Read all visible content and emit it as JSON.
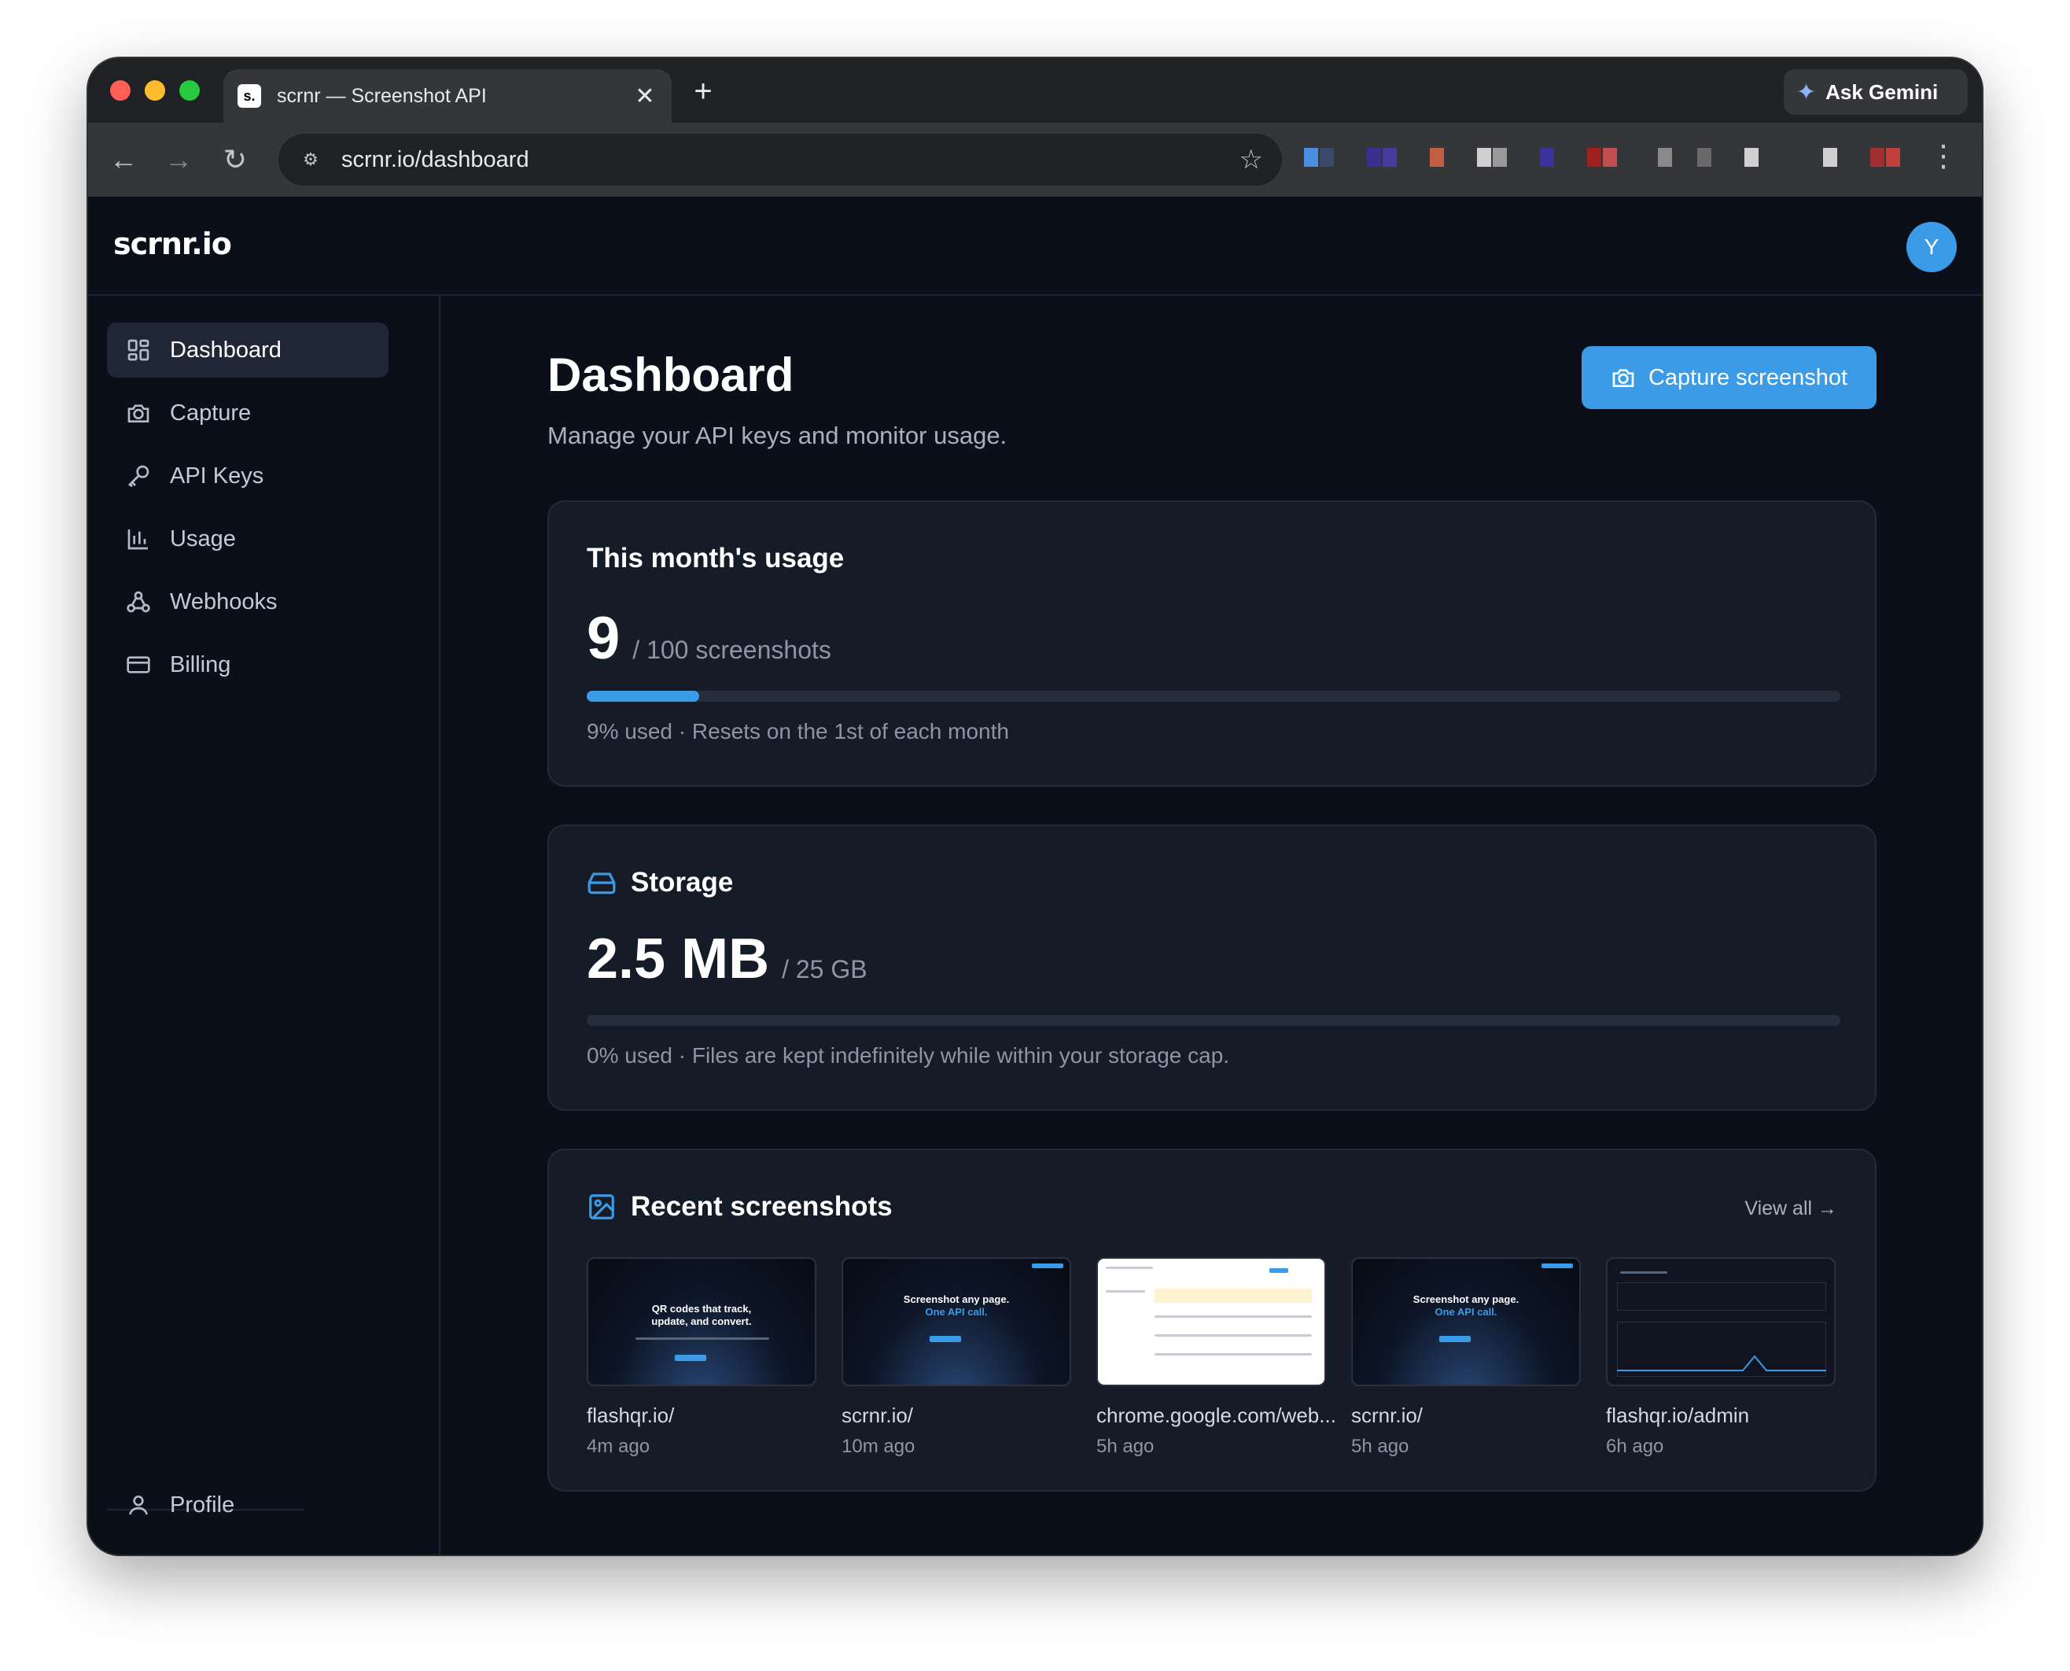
{
  "browser": {
    "tab_title": "scrnr — Screenshot API",
    "favicon_text": "s.",
    "new_tab": "+",
    "close": "✕",
    "gemini_label": "Ask Gemini",
    "url": "scrnr.io/dashboard"
  },
  "app": {
    "brand": "scrnr.io",
    "avatar_initial": "Y"
  },
  "sidebar": {
    "items": [
      {
        "label": "Dashboard",
        "icon": "dashboard-grid-icon",
        "active": true
      },
      {
        "label": "Capture",
        "icon": "camera-icon"
      },
      {
        "label": "API Keys",
        "icon": "key-icon"
      },
      {
        "label": "Usage",
        "icon": "bar-chart-icon"
      },
      {
        "label": "Webhooks",
        "icon": "webhook-icon"
      },
      {
        "label": "Billing",
        "icon": "credit-card-icon"
      }
    ],
    "profile_label": "Profile"
  },
  "main": {
    "title": "Dashboard",
    "subtitle": "Manage your API keys and monitor usage.",
    "capture_button": "Capture screenshot"
  },
  "usage_card": {
    "title": "This month's usage",
    "value": "9",
    "unit": "/ 100 screenshots",
    "percent_used": 0.09,
    "note": "9% used · Resets on the 1st of each month"
  },
  "storage_card": {
    "title": "Storage",
    "value": "2.5 MB",
    "unit": "/ 25 GB",
    "percent_used": 0.0,
    "note": "0% used · Files are kept indefinitely while within your storage cap."
  },
  "recent": {
    "title": "Recent screenshots",
    "view_all": "View all →",
    "items": [
      {
        "name": "flashqr.io/",
        "time": "4m ago",
        "thumb_heading": "QR codes that track,",
        "thumb_heading2": "update, and convert."
      },
      {
        "name": "scrnr.io/",
        "time": "10m ago",
        "thumb_heading": "Screenshot any page.",
        "thumb_heading2": "One API call."
      },
      {
        "name": "chrome.google.com/web...",
        "time": "5h ago"
      },
      {
        "name": "scrnr.io/",
        "time": "5h ago",
        "thumb_heading": "Screenshot any page.",
        "thumb_heading2": "One API call."
      },
      {
        "name": "flashqr.io/admin",
        "time": "6h ago"
      }
    ]
  },
  "colors": {
    "accent": "#3b9be6",
    "background": "#0b0f19",
    "card": "#161b28"
  }
}
